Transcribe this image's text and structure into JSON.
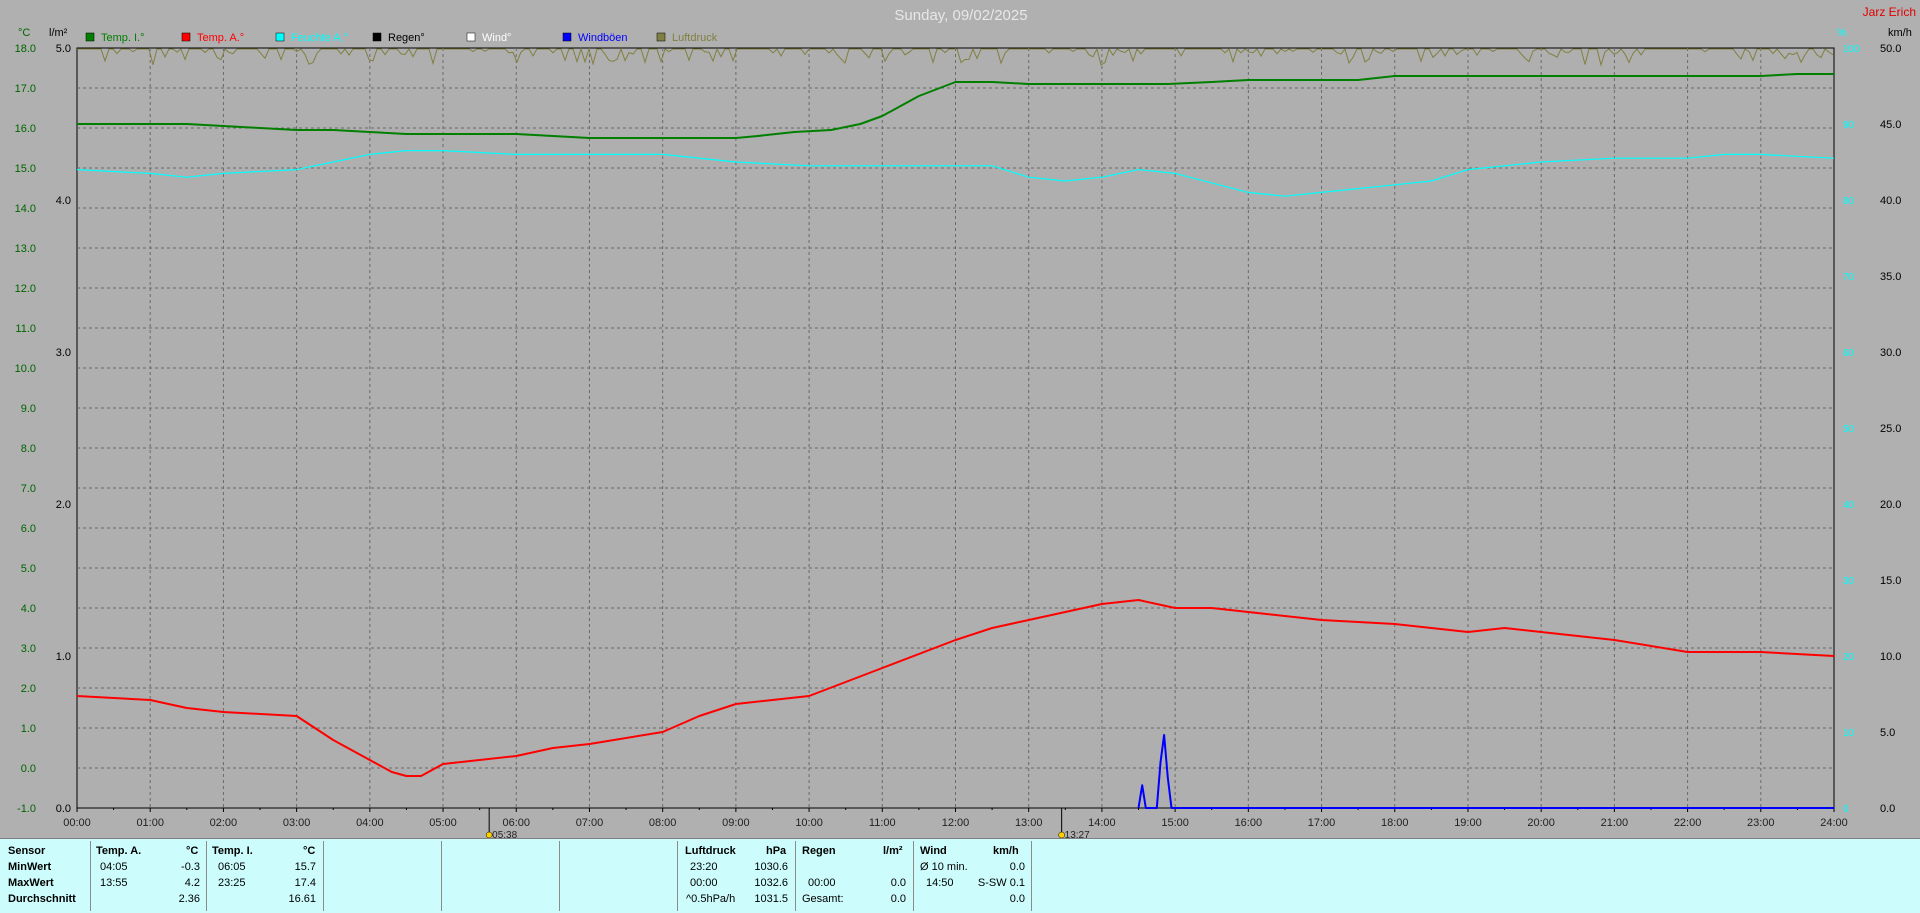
{
  "header": {
    "title": "Sunday, 09/02/2025",
    "brand": "Jarz Erich"
  },
  "chart_data": {
    "type": "line",
    "title": "Sunday, 09/02/2025",
    "axes": {
      "left_temp": {
        "unit": "°C",
        "range": [
          -1.0,
          18.0
        ],
        "ticks": [
          "18.0",
          "17.0",
          "16.0",
          "15.0",
          "14.0",
          "13.0",
          "12.0",
          "11.0",
          "10.0",
          "9.0",
          "8.0",
          "7.0",
          "6.0",
          "5.0",
          "4.0",
          "3.0",
          "2.0",
          "1.0",
          "0.0",
          "-1.0"
        ]
      },
      "left_rain": {
        "unit": "l/m²",
        "range": [
          0.0,
          5.0
        ],
        "ticks": [
          "5.0",
          "4.0",
          "3.0",
          "2.0",
          "1.0",
          "0.0"
        ]
      },
      "right_wind": {
        "unit": "km/h",
        "range": [
          0.0,
          50.0
        ],
        "ticks": [
          "50.0",
          "45.0",
          "40.0",
          "35.0",
          "30.0",
          "25.0",
          "20.0",
          "15.0",
          "10.0",
          "5.0",
          "0.0"
        ]
      },
      "right_humidity": {
        "unit": "%",
        "ticks": [
          "100",
          "90",
          "80",
          "70",
          "60",
          "50",
          "40",
          "30",
          "20",
          "10",
          "0"
        ]
      },
      "x_ticks": [
        "00:00",
        "01:00",
        "02:00",
        "03:00",
        "04:00",
        "05:00",
        "06:00",
        "07:00",
        "08:00",
        "09:00",
        "10:00",
        "11:00",
        "12:00",
        "13:00",
        "14:00",
        "15:00",
        "16:00",
        "17:00",
        "18:00",
        "19:00",
        "20:00",
        "21:00",
        "22:00",
        "23:00",
        "24:00"
      ]
    },
    "grid": true,
    "legend_position": "top-left",
    "legend": [
      {
        "name": "Temp. I.°",
        "color": "#007f00"
      },
      {
        "name": "Temp. A.°",
        "color": "#ff0000"
      },
      {
        "name": "Feuchte A.°",
        "color": "#00ffff"
      },
      {
        "name": "Regen°",
        "color": "#000000"
      },
      {
        "name": "Wind°",
        "color": "#ffffff"
      },
      {
        "name": "Windböen",
        "color": "#0000ff"
      },
      {
        "name": "Luftdruck",
        "color": "#808040"
      }
    ],
    "sun_markers": [
      {
        "label": "05:38",
        "hour": 5.63
      },
      {
        "label": "13:27",
        "hour": 13.45
      }
    ],
    "series": [
      {
        "name": "Temp. I.°",
        "axis": "left_temp",
        "color": "#007f00",
        "x": [
          0,
          1.5,
          2,
          2.5,
          3,
          3.5,
          4,
          4.5,
          5,
          6,
          6.5,
          7,
          8,
          9,
          9.3,
          9.8,
          10.3,
          10.7,
          11,
          11.5,
          12,
          12.5,
          13,
          14,
          14.9,
          15.5,
          16,
          17,
          17.5,
          18,
          19,
          20,
          21,
          22,
          23,
          23.5,
          24
        ],
        "y": [
          16.1,
          16.1,
          16.05,
          16.0,
          15.95,
          15.95,
          15.9,
          15.85,
          15.85,
          15.85,
          15.8,
          15.75,
          15.75,
          15.75,
          15.8,
          15.9,
          15.95,
          16.1,
          16.3,
          16.8,
          17.15,
          17.15,
          17.1,
          17.1,
          17.1,
          17.15,
          17.2,
          17.2,
          17.2,
          17.3,
          17.3,
          17.3,
          17.3,
          17.3,
          17.3,
          17.35,
          17.35
        ]
      },
      {
        "name": "Temp. A.°",
        "axis": "left_temp",
        "color": "#ff0000",
        "x": [
          0,
          1,
          1.5,
          2,
          3,
          3.5,
          4,
          4.3,
          4.5,
          4.7,
          5,
          5.5,
          6,
          6.5,
          7,
          8,
          8.5,
          9,
          9.5,
          10,
          11,
          12,
          12.5,
          13,
          13.5,
          14,
          14.5,
          15,
          15.5,
          16,
          17,
          18,
          18.5,
          19,
          19.5,
          20,
          21,
          22,
          23,
          24
        ],
        "y": [
          1.8,
          1.7,
          1.5,
          1.4,
          1.3,
          0.7,
          0.2,
          -0.1,
          -0.2,
          -0.2,
          0.1,
          0.2,
          0.3,
          0.5,
          0.6,
          0.9,
          1.3,
          1.6,
          1.7,
          1.8,
          2.5,
          3.2,
          3.5,
          3.7,
          3.9,
          4.1,
          4.2,
          4.0,
          4.0,
          3.9,
          3.7,
          3.6,
          3.5,
          3.4,
          3.5,
          3.4,
          3.2,
          2.9,
          2.9,
          2.8
        ]
      },
      {
        "name": "Feuchte A.°",
        "axis": "right_humidity",
        "color": "#00ffff",
        "x": [
          0,
          1,
          1.5,
          2,
          3,
          3.5,
          4,
          4.5,
          5,
          6,
          7,
          8,
          9,
          10,
          11,
          12,
          12.5,
          13,
          13.5,
          14,
          14.5,
          15,
          16,
          16.5,
          17,
          17.5,
          18,
          18.5,
          19,
          20,
          21,
          22,
          22.5,
          23,
          24
        ],
        "y": [
          84,
          83.5,
          83,
          83.5,
          84,
          85,
          86,
          86.5,
          86.5,
          86,
          86,
          86,
          85,
          84.5,
          84.5,
          84.5,
          84.5,
          83,
          82.5,
          83,
          84,
          83.5,
          81,
          80.5,
          81,
          81.5,
          82,
          82.5,
          84,
          85,
          85.5,
          85.5,
          86,
          86,
          85.5
        ]
      },
      {
        "name": "Windböen",
        "axis": "right_wind",
        "color": "#0000ff",
        "x": [
          14.5,
          14.55,
          14.6,
          14.75,
          14.8,
          14.85,
          14.9,
          14.95,
          15.0,
          24
        ],
        "y": [
          0,
          1.5,
          0,
          0,
          3.0,
          4.8,
          2.0,
          0,
          0,
          0
        ]
      },
      {
        "name": "Luftdruck",
        "axis": "right_wind",
        "color": "#808040",
        "style": "noise-top"
      }
    ]
  },
  "footer": {
    "headers": {
      "sensor": "Sensor",
      "temp_a": "Temp. A.",
      "unit_c": "°C",
      "temp_i": "Temp. I.",
      "unit_c2": "°C",
      "luftdruck": "Luftdruck",
      "unit_hpa": "hPa",
      "regen": "Regen",
      "unit_lm": "l/m²",
      "wind": "Wind",
      "unit_kmh": "km/h"
    },
    "rows": [
      {
        "label": "MinWert",
        "ta_time": "04:05",
        "ta_val": "-0.3",
        "ti_time": "06:05",
        "ti_val": "15.7",
        "lp_time": "23:20",
        "lp_val": "1030.6",
        "r_time": "",
        "r_val": "",
        "w_label": "Ø 10 min.",
        "w_val": "0.0"
      },
      {
        "label": "MaxWert",
        "ta_time": "13:55",
        "ta_val": "4.2",
        "ti_time": "23:25",
        "ti_val": "17.4",
        "lp_time": "00:00",
        "lp_val": "1032.6",
        "r_time": "00:00",
        "r_val": "0.0",
        "w_label": "14:50",
        "w_dir": "S-SW 0.1",
        "w_val": ""
      },
      {
        "label": "Durchschnitt",
        "ta_time": "",
        "ta_val": "2.36",
        "ti_time": "",
        "ti_val": "16.61",
        "lp_time": "^0.5hPa/h",
        "lp_val": "1031.5",
        "r_time": "Gesamt:",
        "r_val": "0.0",
        "w_label": "",
        "w_val": "0.0"
      }
    ]
  }
}
